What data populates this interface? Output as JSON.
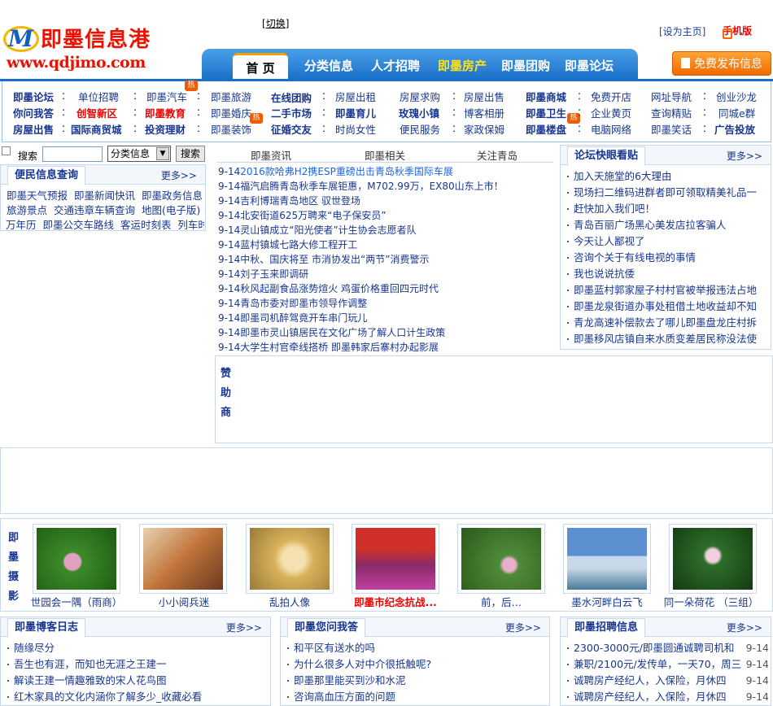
{
  "header": {
    "logo_brand": "即墨信息港",
    "logo_m": "M",
    "logo_url": "www.qdjimo.com",
    "switch_label": "切换",
    "set_home": "[设为主页]",
    "mobile": "手机版",
    "post_button": "免费发布信息"
  },
  "nav": [
    {
      "label": "首 页"
    },
    {
      "label": "分类信息"
    },
    {
      "label": "人才招聘"
    },
    {
      "label": "即墨房产"
    },
    {
      "label": "即墨团购"
    },
    {
      "label": "即墨论坛"
    }
  ],
  "grid": {
    "c1": [
      "即墨论坛",
      "你问我答",
      "房屋出售"
    ],
    "c2": [
      "单位招聘",
      "创智新区",
      "国际商贸城"
    ],
    "c3": [
      "即墨汽车",
      "即墨教育",
      "投资理财"
    ],
    "c4": [
      "即墨旅游",
      "即墨婚庆",
      "即墨装饰"
    ],
    "c5": [
      "在线团购",
      "二手市场",
      "征婚交友"
    ],
    "c6": [
      "房屋出租",
      "即墨育儿",
      "时尚女性"
    ],
    "c7": [
      "房屋求购",
      "玫瑰小镇",
      "便民服务"
    ],
    "c8": [
      "房屋出售",
      "博客相册",
      "家政保姆"
    ],
    "c9": [
      "即墨商城",
      "即墨卫生",
      "即墨楼盘"
    ],
    "c10": [
      "免费开店",
      "企业黄页",
      "电脑网络"
    ],
    "c11": [
      "网址导航",
      "查询精贴",
      "即墨笑话"
    ],
    "c12": [
      "创业沙龙",
      "同城e群",
      "广告投放"
    ],
    "hot": "热",
    "colon": "："
  },
  "search": {
    "label": "搜索",
    "select_value": "分类信息",
    "button": "搜索"
  },
  "convenience": {
    "title": "便民信息查询",
    "more": "更多>>",
    "rows": [
      [
        "即墨天气预报",
        "即墨新闻快讯",
        "即墨政务信息"
      ],
      [
        "旅游景点",
        "交通违章车辆查询",
        "地图(电子版)"
      ],
      [
        "万年历",
        "即墨公交车路线",
        "客运时刻表",
        "列车时"
      ]
    ]
  },
  "news_tabs": [
    "即墨资讯",
    "即墨相关",
    "关注青岛"
  ],
  "news": [
    {
      "date": "9-14",
      "title": "2016款哈弗H2携ESP重磅出击青岛秋季国际车展"
    },
    {
      "date": "9-14",
      "title": "福汽启腾青岛秋季车展钜惠，M702.99万，EX80山东上市！"
    },
    {
      "date": "9-14",
      "title": "吉利博瑞青岛地区 驭世登场"
    },
    {
      "date": "9-14",
      "title": "北安街道625万聘来“电子保安员”"
    },
    {
      "date": "9-14",
      "title": "灵山镇成立“阳光使者”计生协会志愿者队"
    },
    {
      "date": "9-14",
      "title": "蓝村镇城七路大修工程开工"
    },
    {
      "date": "9-14",
      "title": "中秋、国庆将至 市消协发出“两节”消费警示"
    },
    {
      "date": "9-14",
      "title": "刘子玉来即调研"
    },
    {
      "date": "9-14",
      "title": "秋风起副食品涨势煊火 鸡蛋价格重回四元时代"
    },
    {
      "date": "9-14",
      "title": "青岛市委对即墨市领导作调整"
    },
    {
      "date": "9-14",
      "title": "即墨司机醉驾竟开车串门玩儿"
    },
    {
      "date": "9-14",
      "title": "即墨市灵山镇居民在文化广场了解人口计生政策"
    },
    {
      "date": "9-14",
      "title": "大学生村官牵线搭桥 即墨韩家后寨村办起影展"
    }
  ],
  "forum": {
    "title": "论坛快眼看贴",
    "more": "更多>>",
    "items": [
      "加入天施堂的6大理由",
      "现场扫二维码进群者即可领取精美礼品一",
      "赶快加入我们吧！",
      "青岛百丽广场黑心美发店拉客骗人",
      "今天让人鄙视了",
      "咨询个关于有线电视的事情",
      "我也说说抗倭",
      "即墨蓝村郭家屋子村村官被举报违法占地",
      "即墨龙泉街道办事处租借土地收益却不知",
      "青龙高速补偿款去了哪儿即墨盘龙庄村拆",
      "即墨移风店镇自来水质变差居民称没法使"
    ]
  },
  "sponsor_label": "赞助商",
  "photos": {
    "label": "即墨摄影",
    "items": [
      {
        "caption": "世园会一隅（雨商）",
        "color": "#3d8a2a"
      },
      {
        "caption": "小小阅兵迷",
        "color": "#c0733a"
      },
      {
        "caption": "乱拍人像",
        "color": "#d8b25a"
      },
      {
        "caption": "即墨市纪念抗战...",
        "color": "#8a2a6a"
      },
      {
        "caption": "前，后…",
        "color": "#4f8a3a"
      },
      {
        "caption": "墨水河畔白云飞",
        "color": "#5b8fcf"
      },
      {
        "caption": "同一朵荷花 （三组）",
        "color": "#2e6e2a"
      }
    ]
  },
  "blog": {
    "title": "即墨博客日志",
    "more": "更多>>",
    "items": [
      "随缘尽分",
      "吾生也有涯，而知也无涯之王建一",
      "解读王建一情趣雅致的宋人花鸟图",
      "红木家具的文化内涵你了解多少_收藏必看"
    ]
  },
  "qa": {
    "title": "即墨您问我答",
    "more": "更多>>",
    "items": [
      "和平区有送水的吗",
      "为什么很多人对中介很抵触呢?",
      "即墨那里能买到沙和水泥",
      "咨询高血压方面的问题"
    ]
  },
  "jobs": {
    "title": "即墨招聘信息",
    "more": "更多>>",
    "items": [
      {
        "text": "2300-3000元/即墨圆通诚聘司机和",
        "date": "9-14"
      },
      {
        "text": "兼职/2100元/发传单，一天70，周三",
        "date": "9-14"
      },
      {
        "text": "诚聘房产经纪人，入保险，月休四",
        "date": "9-14"
      },
      {
        "text": "诚聘房产经纪人，入保险，月休四",
        "date": "9-14"
      }
    ]
  }
}
